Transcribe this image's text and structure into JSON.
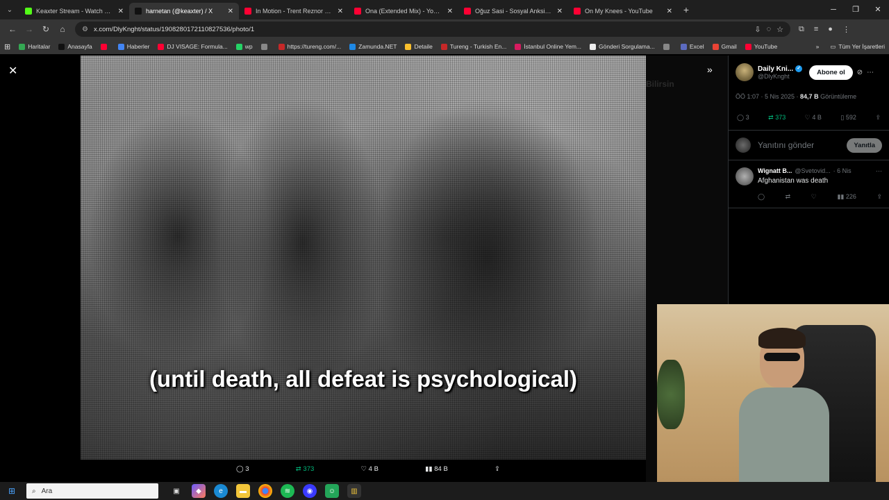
{
  "browser": {
    "tabs": [
      {
        "title": "Keaxter Stream - Watch Live on",
        "color": "#53fc18",
        "active": false
      },
      {
        "title": "harnetan (@keaxter) / X",
        "color": "#111111",
        "active": true
      },
      {
        "title": "In Motion - Trent Reznor and A",
        "color": "#ff0033",
        "active": false
      },
      {
        "title": "Ona (Extended Mix) - YouTu",
        "color": "#ff0033",
        "active": false
      },
      {
        "title": "Oğuz Sasi - Sosyal Anksiyete - Y",
        "color": "#ff0033",
        "active": false
      },
      {
        "title": "On My Knees - YouTube",
        "color": "#ff0033",
        "active": false
      }
    ],
    "url": "x.com/DlyKnght/status/1908280172110827536/photo/1",
    "bookmarks": [
      {
        "label": "Haritalar",
        "color": "#34a853"
      },
      {
        "label": "Anasayfa",
        "color": "#111111"
      },
      {
        "label": "",
        "color": "#ff0033"
      },
      {
        "label": "Haberler",
        "color": "#4285f4"
      },
      {
        "label": "DJ VISAGE: Formula...",
        "color": "#ff0033"
      },
      {
        "label": "wp",
        "color": "#25d366"
      },
      {
        "label": "",
        "color": "#888888"
      },
      {
        "label": "https://tureng.com/...",
        "color": "#c62828"
      },
      {
        "label": "Zamunda.NET",
        "color": "#1e88e5"
      },
      {
        "label": "Detaile",
        "color": "#fbc02d"
      },
      {
        "label": "Tureng - Turkish En...",
        "color": "#c62828"
      },
      {
        "label": "İstanbul Online Yem...",
        "color": "#d81b60"
      },
      {
        "label": "Gönderi Sorgulama...",
        "color": "#eeeeee"
      },
      {
        "label": "",
        "color": "#888888"
      },
      {
        "label": "Excel",
        "color": "#5c6bc0"
      },
      {
        "label": "Gmail",
        "color": "#ea4335"
      },
      {
        "label": "YouTube",
        "color": "#ff0033"
      }
    ],
    "bookmarks_all": "Tüm Yer İşaretleri"
  },
  "viewer": {
    "caption": "(until death, all defeat is psychological)",
    "actions": {
      "replies": "3",
      "retweets": "373",
      "likes": "4 B",
      "views": "84 B"
    },
    "faded_labels": [
      "Bilirsin"
    ]
  },
  "panel": {
    "name": "Daily Kni...",
    "handle": "@DlyKnght",
    "subscribe": "Abone ol",
    "time": "ÖÖ 1:07 · 5 Nis 2025 · ",
    "views_count": "84,7 B",
    "views_label": " Görüntüleme",
    "actions": {
      "replies": "3",
      "retweets": "373",
      "likes": "4 B",
      "bookmarks": "592"
    },
    "reply_placeholder": "Yanıtını gönder",
    "reply_button": "Yanıtla",
    "comment": {
      "name": "Wignatt B...",
      "handle": "@Svetovid...",
      "date": "· 6 Nis",
      "text": "Afghanistan was death",
      "views": "226"
    }
  },
  "taskbar": {
    "search_placeholder": "Ara"
  }
}
